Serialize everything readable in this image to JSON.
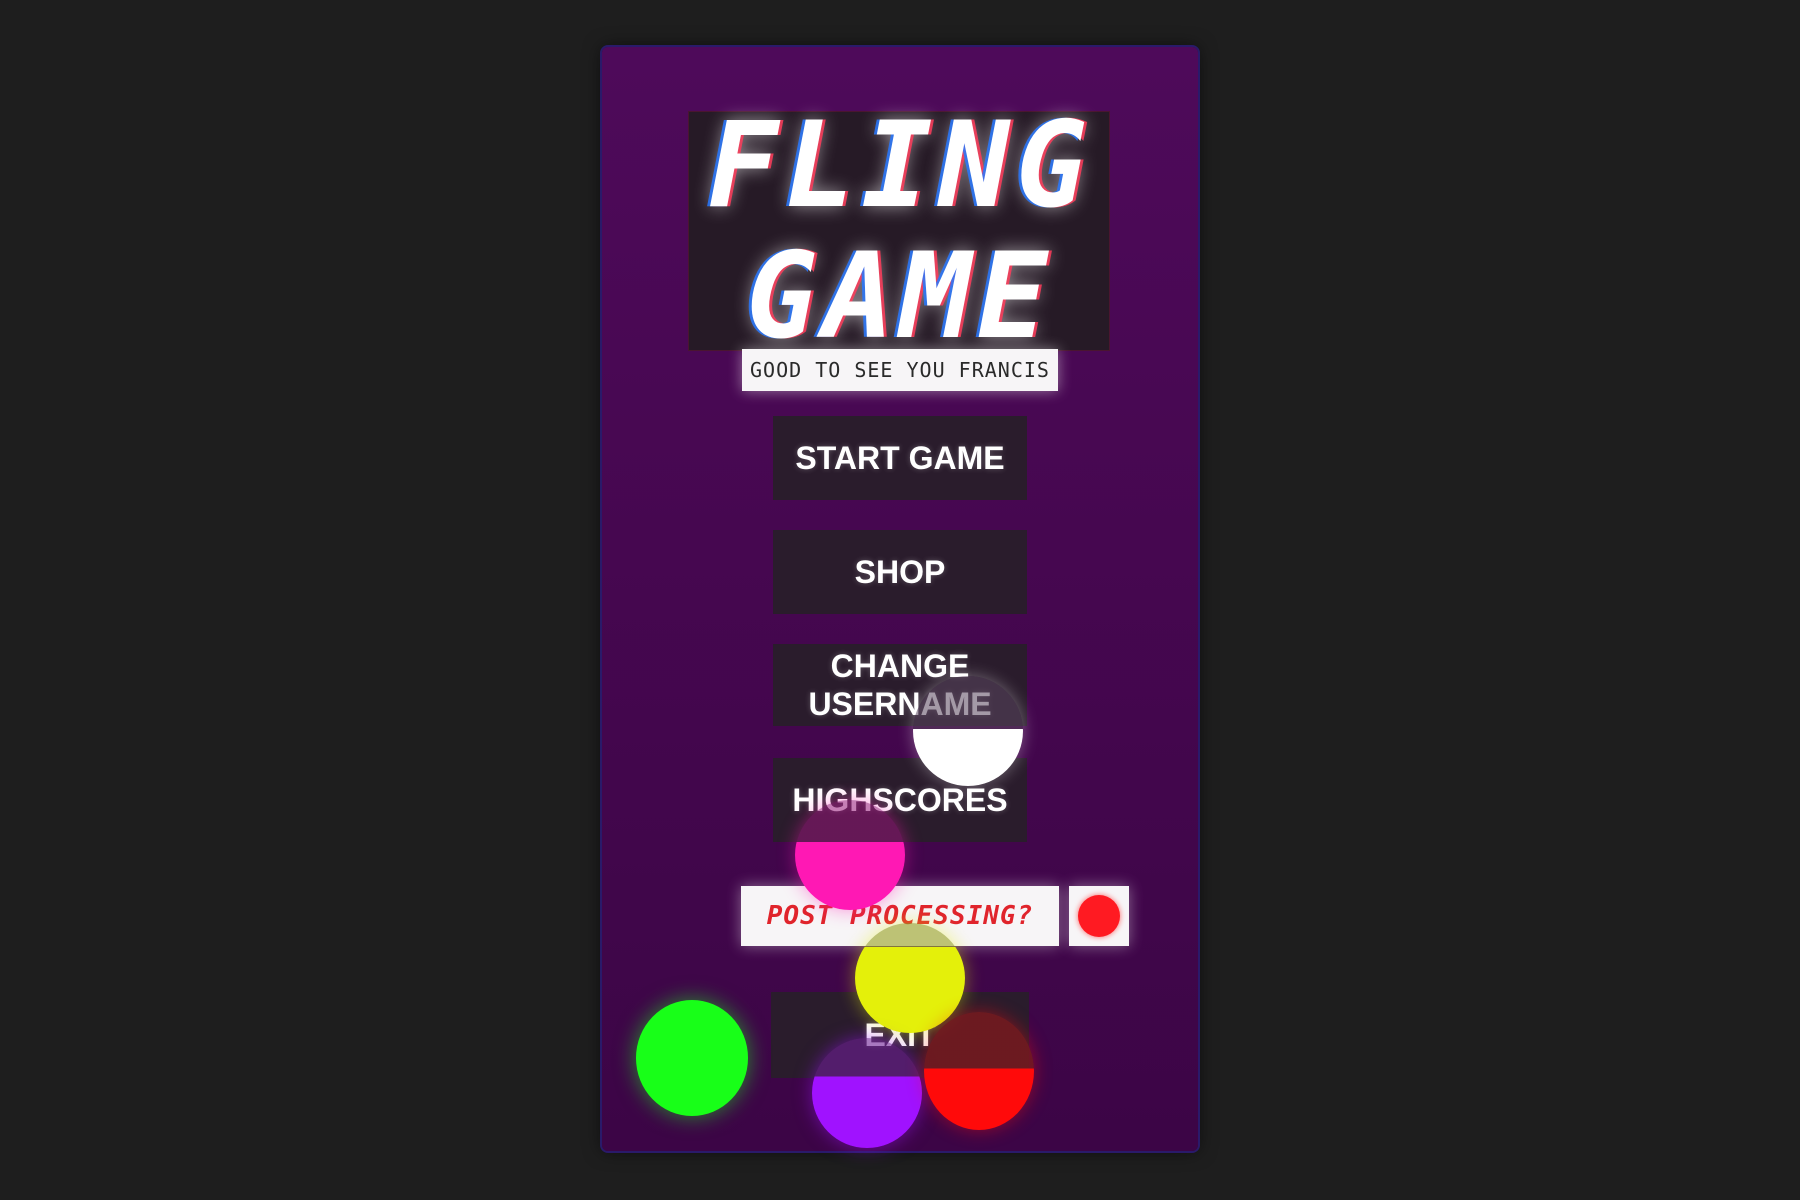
{
  "title": {
    "line1": "FLING",
    "line2": "GAME"
  },
  "greeting": "GOOD TO SEE YOU FRANCIS",
  "menu": {
    "start": "START GAME",
    "shop": "SHOP",
    "change_username_line1": "CHANGE",
    "change_username_line2": "USERNAME",
    "highscores": "HIGHSCORES",
    "exit": "EXIT"
  },
  "post_processing": {
    "label": "POST PROCESSING?",
    "toggle_color": "#ff1a22"
  },
  "colors": {
    "background": "#1e1e1e",
    "panel": "#4a0855",
    "button_bg": "#2a1c2c",
    "ball_white": "#ffffff",
    "ball_magenta": "#ff18b4",
    "ball_yellow": "#e4f00a",
    "ball_green": "#18ff18",
    "ball_purple": "#a012ff",
    "ball_red": "#ff0a0a"
  }
}
